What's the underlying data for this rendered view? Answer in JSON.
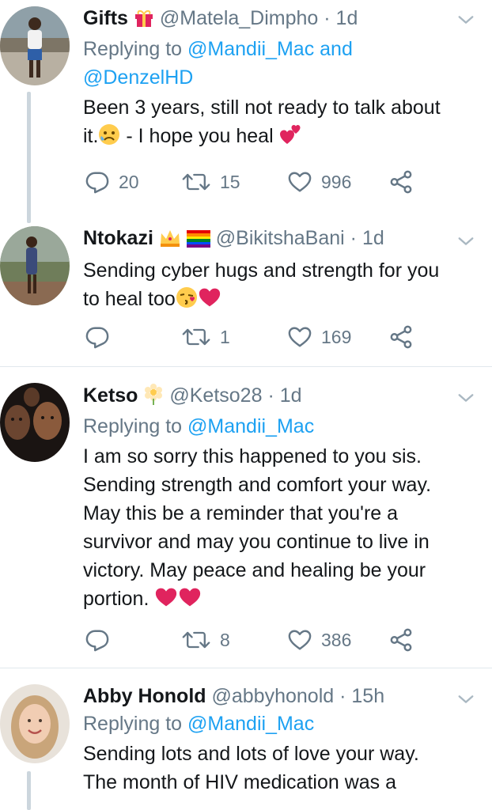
{
  "tweets": [
    {
      "name": "Gifts",
      "handle": "@Matela_Dimpho",
      "time": "· 1d",
      "reply_prefix": "Replying to",
      "reply_mentions_1": "@Mandii_Mac",
      "reply_and": "and",
      "reply_mentions_2": "@DenzelHD",
      "text_1": "Been 3 years, still not ready to talk about",
      "text_2a": "it.",
      "text_2b": " -  I hope you heal",
      "replies": "20",
      "retweets": "15",
      "likes": "996"
    },
    {
      "name": "Ntokazi",
      "handle": "@BikitshaBani",
      "time": "· 1d",
      "text_1": "Sending cyber hugs and strength for you",
      "text_2": "to heal too",
      "replies": "",
      "retweets": "1",
      "likes": "169"
    },
    {
      "name": "Ketso",
      "handle": "@Ketso28",
      "time": "· 1d",
      "reply_prefix": "Replying to",
      "reply_mentions_1": "@Mandii_Mac",
      "lines": [
        "I am so sorry this happened to you sis.",
        "Sending strength and comfort your way.",
        "May this be a reminder that you're a",
        "survivor and may you continue to live in",
        "victory. May peace and healing be your",
        "portion."
      ],
      "replies": "",
      "retweets": "8",
      "likes": "386"
    },
    {
      "name": "Abby Honold",
      "handle": "@abbyhonold",
      "time": "· 15h",
      "reply_prefix": "Replying to",
      "reply_mentions_1": "@Mandii_Mac",
      "lines": [
        "Sending lots and lots of love your way.",
        "The month of HIV medication was a"
      ]
    }
  ],
  "colors": {
    "text": "#14171a",
    "secondary": "#657786",
    "link": "#1da1f2",
    "heart": "#e0245e",
    "divider": "#e1e8ed"
  },
  "icons": [
    "reply-icon",
    "retweet-icon",
    "like-icon",
    "share-icon",
    "chevron-down-icon"
  ]
}
